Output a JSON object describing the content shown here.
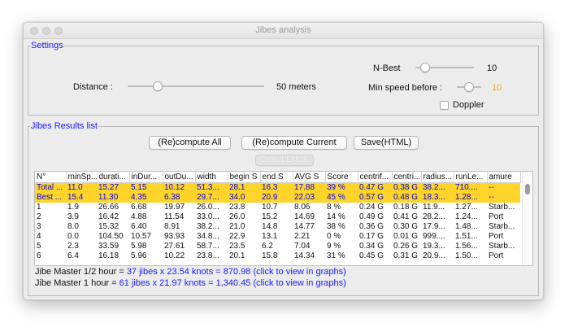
{
  "window": {
    "title": "Jibes analysis"
  },
  "settings": {
    "legend": "Settings",
    "distance": {
      "label": "Distance :",
      "value_text": "50 meters",
      "slider_fraction": 0.2
    },
    "n_best": {
      "label": "N-Best",
      "value_text": "10",
      "slider_fraction": 0.1
    },
    "min_speed": {
      "label": "Min speed before :",
      "value_text": "10",
      "value_color": "#f5a623",
      "slider_fraction": 0.5
    },
    "doppler": {
      "label": "Doppler",
      "checked": false
    }
  },
  "results": {
    "legend": "Jibes Results list",
    "buttons": {
      "recompute_all": "(Re)compute All",
      "recompute_current": "(Re)compute Current",
      "save_html": "Save(HTML)",
      "challenge": "CHALLENGE"
    },
    "table": {
      "columns": [
        "N°",
        "minSp...",
        "durati...",
        "inDur...",
        "outDu...",
        "width",
        "begin S",
        "end S",
        "AVG S",
        "Score",
        "centrif...",
        "centri...",
        "radius...",
        "runLe...",
        "amure"
      ],
      "rows": [
        [
          "Total ...",
          "11.0",
          "15.27",
          "5.15",
          "10.12",
          "51.3...",
          "28.1",
          "16.3",
          "17.88",
          "39 %",
          "0.47 G",
          "0.38 G",
          "38.2...",
          "710....",
          "--"
        ],
        [
          "Best ...",
          "15.4",
          "11.30",
          "4.35",
          "6.38",
          "29.7...",
          "34.0",
          "20.9",
          "22.03",
          "45 %",
          "0.57 G",
          "0.48 G",
          "18.3...",
          "1.28...",
          "--"
        ],
        [
          "1",
          "1.9",
          "26.66",
          "6.68",
          "19.97",
          "26.0...",
          "23.8",
          "10.7",
          "8.06",
          "8 %",
          "0.24 G",
          "0.18 G",
          "11.9...",
          "1.27...",
          "Starb..."
        ],
        [
          "2",
          "3.9",
          "16.42",
          "4.88",
          "11.54",
          "33.0...",
          "26.0",
          "15.2",
          "14.69",
          "14 %",
          "0.49 G",
          "0.41 G",
          "28.2...",
          "1.24...",
          "Port"
        ],
        [
          "3",
          "8.0",
          "15.32",
          "6.40",
          "8.91",
          "38.2...",
          "21.0",
          "14.8",
          "14.77",
          "38 %",
          "0.36 G",
          "0.30 G",
          "17.9...",
          "1.48...",
          "Starb..."
        ],
        [
          "4",
          "0.0",
          "104.50",
          "10.57",
          "93.93",
          "34.8...",
          "22.9",
          "13.1",
          "2.21",
          "0 %",
          "0.17 G",
          "0.01 G",
          "999....",
          "1.51...",
          "Port"
        ],
        [
          "5",
          "2.3",
          "33.59",
          "5.98",
          "27.61",
          "58.7...",
          "23.5",
          "6.2",
          "7.04",
          "9 %",
          "0.34 G",
          "0.26 G",
          "19.3...",
          "1.56...",
          "Starb..."
        ],
        [
          "6",
          "6.4",
          "16.18",
          "5.96",
          "10.22",
          "23.8...",
          "20.1",
          "15.8",
          "14.34",
          "31 %",
          "0.45 G",
          "0.31 G",
          "20.9...",
          "1.50...",
          "Port"
        ]
      ],
      "highlight_color": "#ffd42a"
    },
    "master_half_hour": {
      "prefix": "Jibe Master 1/2 hour = ",
      "link": "37 jibes  x  23.54 knots  =  870.98 (click to view in graphs)"
    },
    "master_hour": {
      "prefix": "Jibe Master 1 hour = ",
      "link": "61 jibes  x  21.97 knots  =  1,340.45 (click to view in graphs)"
    }
  }
}
